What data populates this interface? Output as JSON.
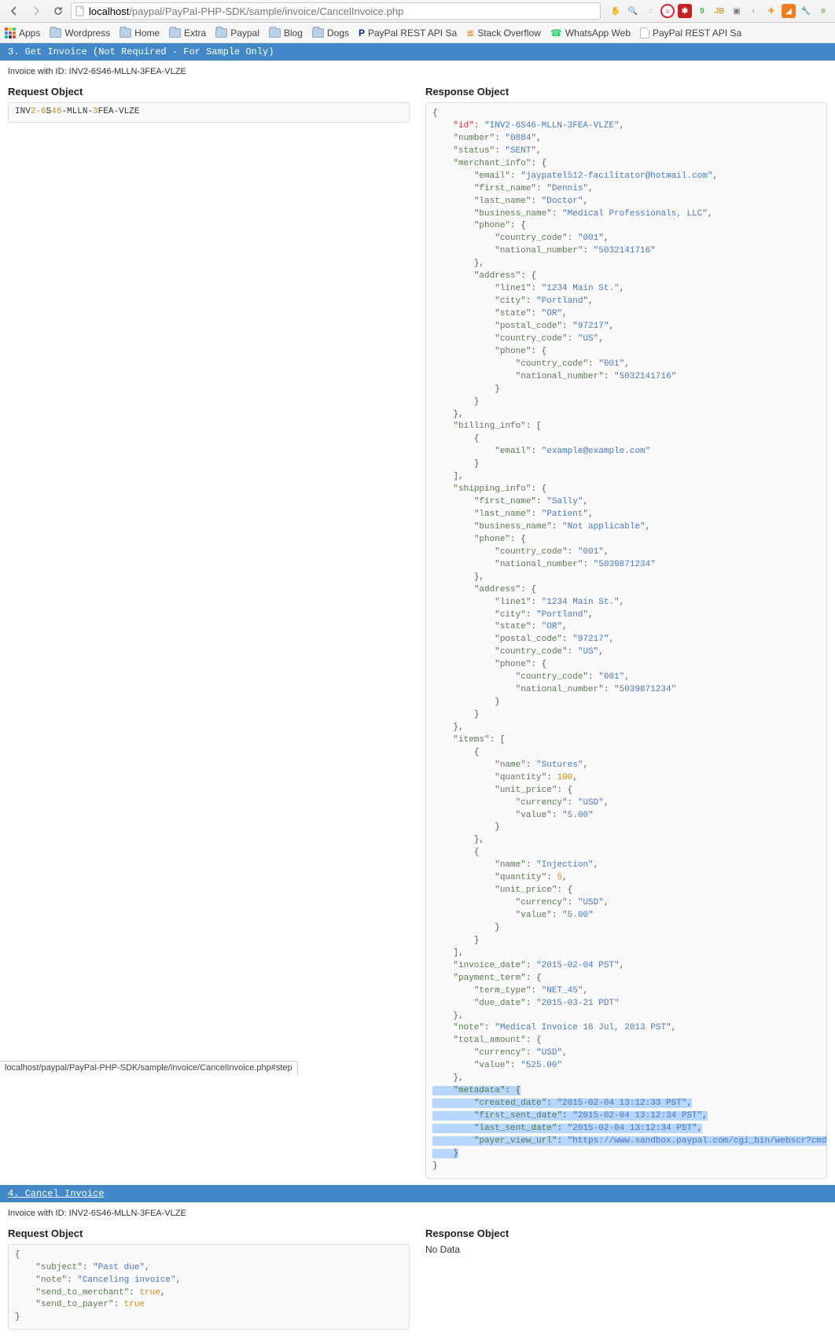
{
  "browser": {
    "url_host": "localhost",
    "url_path": "/paypal/PayPal-PHP-SDK/sample/invoice/CancelInvoice.php",
    "status_url": "localhost/paypal/PayPal-PHP-SDK/sample/invoice/CancelInvoice.php#step"
  },
  "bookmarks": {
    "apps": "Apps",
    "items": [
      "Wordpress",
      "Home",
      "Extra",
      "Paypal",
      "Blog",
      "Dogs",
      "PayPal REST API Sa",
      "Stack Overflow",
      "WhatsApp Web",
      "PayPal REST API Sa"
    ]
  },
  "step3": {
    "title": "3. Get Invoice (Not Required - For Sample Only)",
    "invoice_line": "Invoice with ID: INV2-6S46-MLLN-3FEA-VLZE",
    "request_title": "Request Object",
    "response_title": "Response Object",
    "request_text": "INV2-6S46-MLLN-3FEA-VLZE",
    "response_json": {
      "id": "INV2-6S46-MLLN-3FEA-VLZE",
      "number": "0884",
      "status": "SENT",
      "merchant_info": {
        "email": "jaypatel512-facilitator@hotmail.com",
        "first_name": "Dennis",
        "last_name": "Doctor",
        "business_name": "Medical Professionals, LLC",
        "phone": {
          "country_code": "001",
          "national_number": "5032141716"
        },
        "address": {
          "line1": "1234 Main St.",
          "city": "Portland",
          "state": "OR",
          "postal_code": "97217",
          "country_code": "US",
          "phone": {
            "country_code": "001",
            "national_number": "5032141716"
          }
        }
      },
      "billing_info": [
        {
          "email": "example@example.com"
        }
      ],
      "shipping_info": {
        "first_name": "Sally",
        "last_name": "Patient",
        "business_name": "Not applicable",
        "phone": {
          "country_code": "001",
          "national_number": "5039871234"
        },
        "address": {
          "line1": "1234 Main St.",
          "city": "Portland",
          "state": "OR",
          "postal_code": "97217",
          "country_code": "US",
          "phone": {
            "country_code": "001",
            "national_number": "5039871234"
          }
        }
      },
      "items": [
        {
          "name": "Sutures",
          "quantity": 100,
          "unit_price": {
            "currency": "USD",
            "value": "5.00"
          }
        },
        {
          "name": "Injection",
          "quantity": 5,
          "unit_price": {
            "currency": "USD",
            "value": "5.00"
          }
        }
      ],
      "invoice_date": "2015-02-04 PST",
      "payment_term": {
        "term_type": "NET_45",
        "due_date": "2015-03-21 PDT"
      },
      "note": "Medical Invoice 16 Jul, 2013 PST",
      "total_amount": {
        "currency": "USD",
        "value": "525.00"
      },
      "metadata": {
        "created_date": "2015-02-04 13:12:33 PST",
        "first_sent_date": "2015-02-04 13:12:34 PST",
        "last_sent_date": "2015-02-04 13:12:34 PST",
        "payer_view_url": "https://www.sandbox.paypal.com/cgi_bin/webscr?cmd=_pay-inv&viewt"
      }
    }
  },
  "step4": {
    "title": "4. Cancel Invoice",
    "invoice_line": "Invoice with ID: INV2-6S46-MLLN-3FEA-VLZE",
    "request_title": "Request Object",
    "response_title": "Response Object",
    "no_data": "No Data",
    "request_json": {
      "subject": "Past due",
      "note": "Canceling invoice",
      "send_to_merchant": true,
      "send_to_payer": true
    }
  }
}
